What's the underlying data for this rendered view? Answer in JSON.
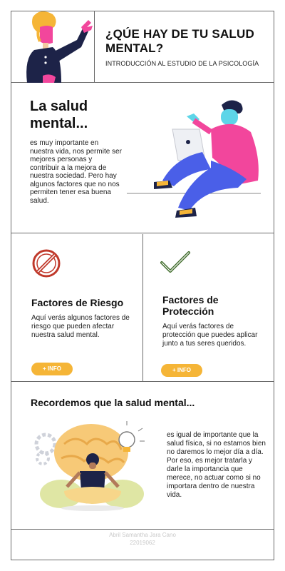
{
  "header": {
    "title": "¿QÚE HAY DE TU SALUD MENTAL?",
    "subtitle": "INTRODUCCIÓN AL ESTUDIO DE LA PSICOLOGÍA"
  },
  "intro": {
    "title": "La salud mental...",
    "body": "es muy importante en nuestra vida, nos permite ser mejores personas y contribuir a la mejora de nuestra sociedad. Pero hay algunos factores que no nos permiten tener esa buena salud."
  },
  "factors": {
    "risk": {
      "icon": "prohibited-icon",
      "title": "Factores de Riesgo",
      "text": "Aquí verás algunos factores de riesgo que pueden afectar nuestra salud mental.",
      "button": "+ INFO"
    },
    "protection": {
      "icon": "checkmark-icon",
      "title": "Factores de Protección",
      "text": "Aquí verás factores de protección que puedes aplicar junto a tus seres queridos.",
      "button": "+ INFO"
    }
  },
  "reminder": {
    "title": "Recordemos que la salud mental...",
    "text": "es igual de importante que la salud física, si no estamos bien no daremos lo mejor día a día. Por eso, es mejor tratarla y darle la importancia que merece, no actuar como si no importara dentro de nuestra vida."
  },
  "footer": {
    "name": "Abril Samantha Jara Cano",
    "id": "22019062"
  },
  "colors": {
    "accent": "#f5b537",
    "pink": "#f2469c",
    "blue": "#4a5fe8",
    "cyan": "#5dd5e8",
    "prohibit_red": "#c0392b",
    "check_green": "#3f6b2a",
    "border": "#6b6b6b"
  }
}
